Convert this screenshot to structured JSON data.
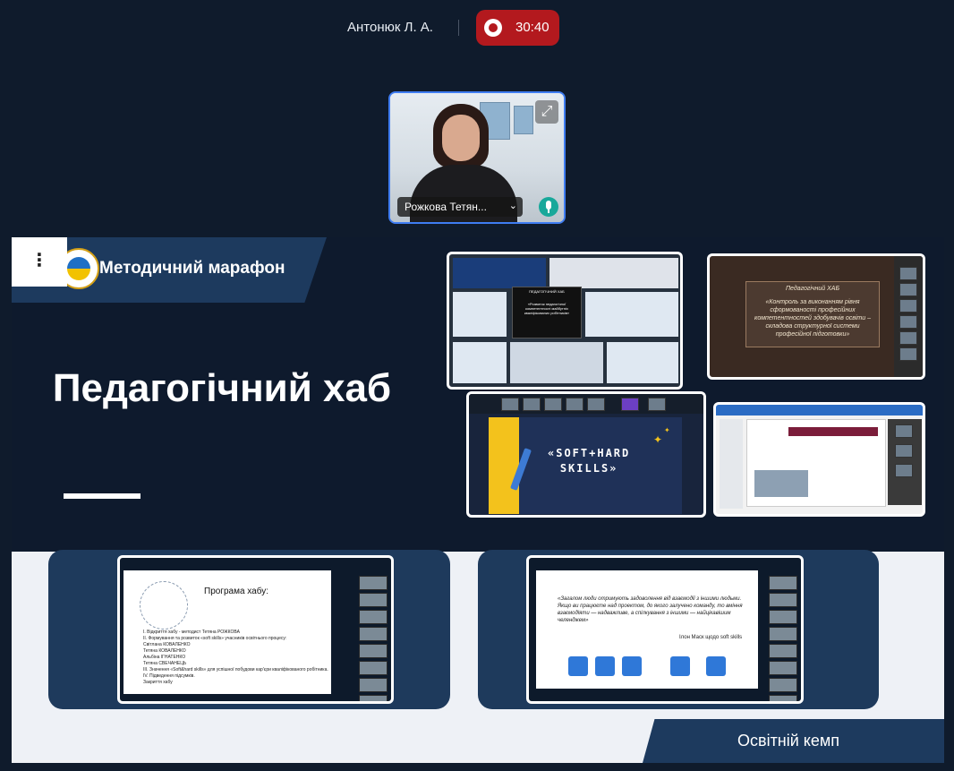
{
  "top_bar": {
    "presenter_name": "Антонюк Л. А.",
    "recording_time": "30:40",
    "recording_color": "#b3191e"
  },
  "camera": {
    "participant_name": "Рожкова Тетян...",
    "name_menu_icon": "chevron-down-icon",
    "expand_icon": "expand-icon",
    "mic_icon": "microphone-icon",
    "active_border_color": "#3f7df2"
  },
  "slide": {
    "menu_label": "⋮",
    "brand_title": "Методичний марафон",
    "hub_title": "Педагогічний хаб",
    "thumbnail_1": {
      "center_text": "«Розвиток педагогічної компетентності майбутніх кваліфікованих робітників»",
      "header_text": "ПЕДАГОГІЧНИЙ ХАБ"
    },
    "thumbnail_2": {
      "board_title": "Педагогічний ХАБ",
      "board_text": "«Контроль за виконанням рівня сформованості професійних компетентностей здобувачів освіти – складова структурної системи професійної підготовки»"
    },
    "thumbnail_3": {
      "skills_text_1": "«SOFT+HARD",
      "skills_text_2": "SKILLS»"
    },
    "card_1": {
      "program_title": "Програма хабу:",
      "program_lines": [
        "I. Відкриття хабу - методист Тетяна РОЖКОВА",
        "II. Формування та розвиток «soft skills» учасників освітнього процесу:",
        "Світлана КОВАЛЕНКО",
        "Тетяна КОВАЛЕНКО",
        "Альбіна ІГНАТЕНКО",
        "Тетяна СВЕЧАНЕЦЬ",
        "III. Значення «Soft&hard skills» для успішної побудови кар'єри кваліфікованого робітника.",
        "IV. Підведення підсумків.",
        "Закриття хабу"
      ]
    },
    "card_2": {
      "quote": "«Загалом люди отримують задоволення від взаємодії з іншими людьми. Якщо ви працюєте над проектом, до якого залучено команду, то вміння взаємодіяти — надважливе, а спілкування з іншими — найцікавішим челенджем»",
      "quote_author": "Ілон Маск щодо soft skills"
    },
    "camp_label": "Освітній кемп"
  },
  "colors": {
    "background": "#0f1b2c",
    "slide_dark": "#0e1a2d",
    "brand_blue": "#1d3a5e",
    "lower_panel": "#eef1f6"
  }
}
